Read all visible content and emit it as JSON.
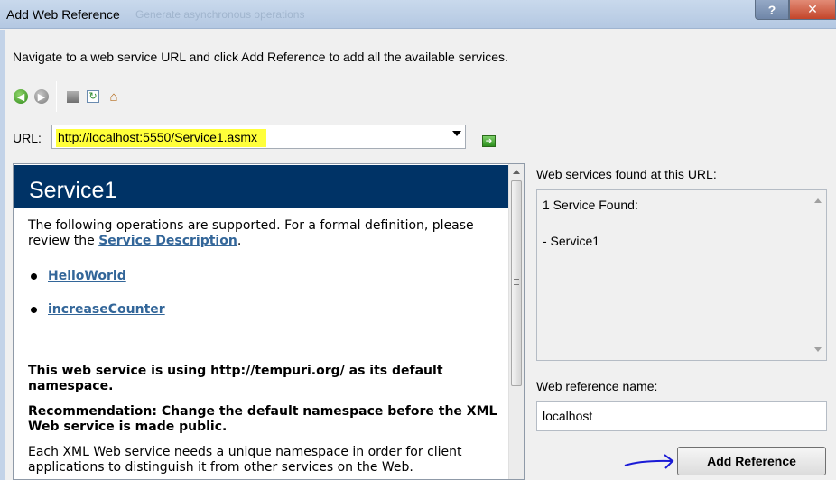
{
  "window": {
    "title": "Add Web Reference",
    "background_text": "Generate asynchronous operations",
    "help_label": "?",
    "close_label": "✕"
  },
  "instructions": "Navigate to a web service URL and click Add Reference to add all the available services.",
  "toolbar": {
    "back_icon": "back-arrow-icon",
    "forward_icon": "forward-arrow-icon",
    "stop_icon": "stop-icon",
    "refresh_icon": "refresh-icon",
    "home_icon": "home-icon"
  },
  "url": {
    "label": "URL:",
    "value": "http://localhost:5550/Service1.asmx",
    "highlight_color": "#ffff3a"
  },
  "browser": {
    "service_title": "Service1",
    "header_color": "#003366",
    "intro_prefix": "The following operations are supported. For a formal definition, please review the ",
    "service_description_link": "Service Description",
    "intro_suffix": ".",
    "operations": [
      "HelloWorld",
      "increaseCounter"
    ],
    "namespace_note": "This web service is using http://tempuri.org/ as its default namespace.",
    "recommendation": "Recommendation: Change the default namespace before the XML Web service is made public.",
    "body_text": "Each XML Web service needs a unique namespace in order for client applications to distinguish it from other services on the Web."
  },
  "found": {
    "label": "Web services found at this URL:",
    "count_text": "1 Service Found:",
    "service_item": "- Service1"
  },
  "reference_name": {
    "label": "Web reference name:",
    "value": "localhost"
  },
  "add_reference_label": "Add Reference",
  "annotation_color": "#1a1ad6"
}
